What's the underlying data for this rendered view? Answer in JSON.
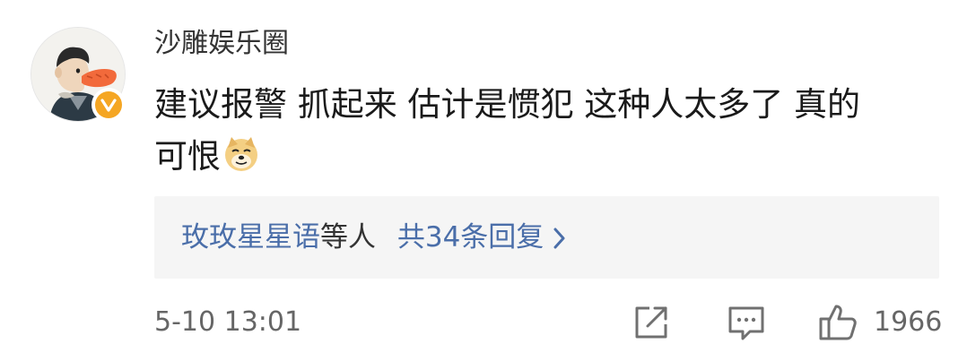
{
  "comment": {
    "username": "沙雕娱乐圈",
    "text_line1": "建议报警 抓起来 估计是惯犯 这种人太多了 真的",
    "text_line2": "可恨",
    "emoji": "doge-emoji",
    "replies": {
      "names": "玫玫星星语",
      "suffix": "等人",
      "total": "共34条回复"
    },
    "time": "5-10 13:01",
    "likes": "1966"
  },
  "colors": {
    "link": "#4a6ea9",
    "text": "#1a1a1a",
    "muted": "#666666",
    "reply_bg": "#f5f5f5",
    "verified_badge": "#f5a623"
  },
  "icons": {
    "verified": "verified-badge-icon",
    "share": "share-icon",
    "comment": "comment-icon",
    "like": "thumbs-up-icon",
    "chevron": "chevron-right-icon"
  }
}
